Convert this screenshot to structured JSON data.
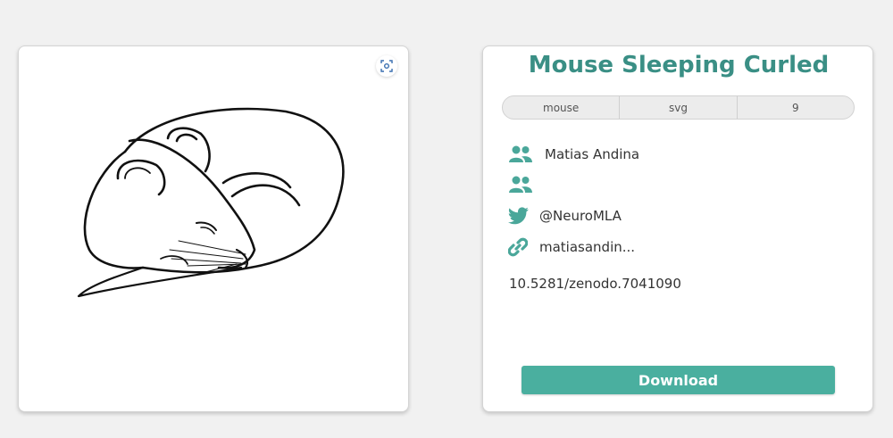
{
  "image_panel": {
    "art_name": "mouse-sleeping-curled-illustration"
  },
  "info_panel": {
    "title": "Mouse Sleeping Curled",
    "tags": [
      "mouse",
      "svg",
      "9"
    ],
    "author": "Matias Andina",
    "contributors": "",
    "twitter": "@NeuroMLA",
    "website": "matiasandin...",
    "doi": "10.5281/zenodo.7041090",
    "download_label": "Download"
  },
  "colors": {
    "accent": "#3a8f85",
    "button": "#4aaf9f",
    "icon": "#4aa79a"
  }
}
